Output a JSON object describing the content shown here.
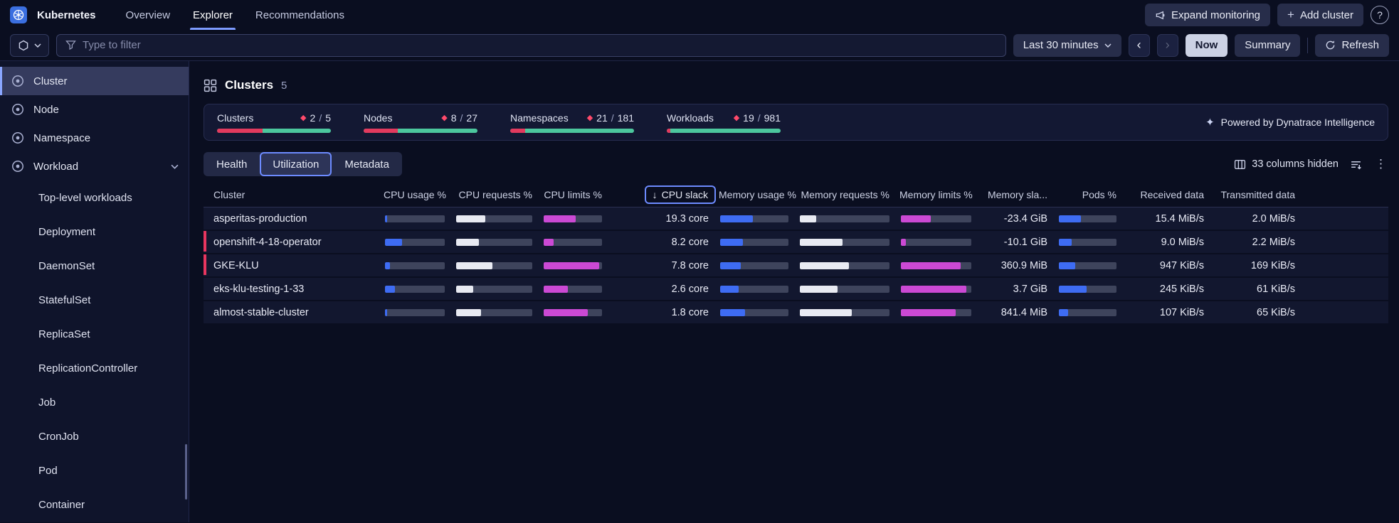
{
  "icons": {
    "help": "?",
    "plus": "+",
    "kebab": "⋮",
    "diamond": "◆",
    "sort_desc": "↓",
    "sparkle": "✦",
    "prev": "‹",
    "next": "›"
  },
  "misc": {
    "fraction_separator": "/"
  },
  "colors": {
    "accent": "#7d9bff",
    "bar_blue": "#3e6cf3",
    "bar_magenta": "#cb49d4",
    "bar_neutral": "#e8eaf2",
    "critical": "#e8365f",
    "healthy": "#4cc79e"
  },
  "app": {
    "title": "Kubernetes"
  },
  "topnav": {
    "items": [
      {
        "label": "Overview",
        "active": false
      },
      {
        "label": "Explorer",
        "active": true
      },
      {
        "label": "Recommendations",
        "active": false
      }
    ],
    "actions": {
      "expand_monitoring": "Expand monitoring",
      "add_cluster": "Add cluster"
    }
  },
  "toolbar": {
    "filter_placeholder": "Type to filter",
    "time_range": "Last 30 minutes",
    "now": "Now",
    "summary": "Summary",
    "refresh": "Refresh"
  },
  "sidebar": {
    "items": [
      {
        "label": "Cluster",
        "selected": true,
        "expanded": false
      },
      {
        "label": "Node",
        "selected": false,
        "expanded": false
      },
      {
        "label": "Namespace",
        "selected": false,
        "expanded": false
      },
      {
        "label": "Workload",
        "selected": false,
        "expanded": true
      }
    ],
    "workload_children": [
      "Top-level workloads",
      "Deployment",
      "DaemonSet",
      "StatefulSet",
      "ReplicaSet",
      "ReplicationController",
      "Job",
      "CronJob",
      "Pod",
      "Container"
    ]
  },
  "main": {
    "title": "Clusters",
    "count": "5",
    "stats": [
      {
        "label": "Clusters",
        "problematic": "2",
        "total": "5",
        "pct": 40
      },
      {
        "label": "Nodes",
        "problematic": "8",
        "total": "27",
        "pct": 30
      },
      {
        "label": "Namespaces",
        "problematic": "21",
        "total": "181",
        "pct": 12
      },
      {
        "label": "Workloads",
        "problematic": "19",
        "total": "981",
        "pct": 3
      }
    ],
    "powered_by": "Powered by Dynatrace Intelligence",
    "tabs": [
      "Health",
      "Utilization",
      "Metadata"
    ],
    "selected_tab": 1,
    "columns_hidden": "33 columns hidden",
    "table": {
      "columns": [
        {
          "label": "Cluster",
          "field": "cluster",
          "type": "text"
        },
        {
          "label": "CPU usage %",
          "field": "cpu_usage",
          "type": "bar",
          "color": "blue"
        },
        {
          "label": "CPU requests %",
          "field": "cpu_requests",
          "type": "bar",
          "color": "white"
        },
        {
          "label": "CPU limits %",
          "field": "cpu_limits",
          "type": "bar",
          "color": "magenta"
        },
        {
          "label": "CPU slack",
          "field": "cpu_slack",
          "type": "value",
          "sorted": true
        },
        {
          "label": "Memory usage %",
          "field": "mem_usage",
          "type": "bar",
          "color": "blue"
        },
        {
          "label": "Memory requests %",
          "field": "mem_requests",
          "type": "bar",
          "color": "white"
        },
        {
          "label": "Memory limits %",
          "field": "mem_limits",
          "type": "bar",
          "color": "magenta"
        },
        {
          "label": "Memory sla...",
          "field": "mem_slack",
          "type": "value"
        },
        {
          "label": "Pods %",
          "field": "pods",
          "type": "bar",
          "color": "blue"
        },
        {
          "label": "Received data",
          "field": "received",
          "type": "value"
        },
        {
          "label": "Transmitted data",
          "field": "transmitted",
          "type": "value"
        }
      ],
      "rows": [
        {
          "cluster": "asperitas-production",
          "critical": false,
          "cpu_usage": 4,
          "cpu_requests": 38,
          "cpu_limits": 55,
          "cpu_slack": "19.3 core",
          "mem_usage": 48,
          "mem_requests": 18,
          "mem_limits": 42,
          "mem_slack": "-23.4 GiB",
          "pods": 38,
          "received": "15.4 MiB/s",
          "transmitted": "2.0 MiB/s"
        },
        {
          "cluster": "openshift-4-18-operator",
          "critical": true,
          "cpu_usage": 28,
          "cpu_requests": 30,
          "cpu_limits": 17,
          "cpu_slack": "8.2 core",
          "mem_usage": 33,
          "mem_requests": 48,
          "mem_limits": 7,
          "mem_slack": "-10.1 GiB",
          "pods": 22,
          "received": "9.0 MiB/s",
          "transmitted": "2.2 MiB/s"
        },
        {
          "cluster": "GKE-KLU",
          "critical": true,
          "cpu_usage": 8,
          "cpu_requests": 48,
          "cpu_limits": 95,
          "cpu_slack": "7.8 core",
          "mem_usage": 30,
          "mem_requests": 55,
          "mem_limits": 85,
          "mem_slack": "360.9 MiB",
          "pods": 28,
          "received": "947 KiB/s",
          "transmitted": "169 KiB/s"
        },
        {
          "cluster": "eks-klu-testing-1-33",
          "critical": false,
          "cpu_usage": 17,
          "cpu_requests": 22,
          "cpu_limits": 42,
          "cpu_slack": "2.6 core",
          "mem_usage": 27,
          "mem_requests": 42,
          "mem_limits": 93,
          "mem_slack": "3.7 GiB",
          "pods": 48,
          "received": "245 KiB/s",
          "transmitted": "61 KiB/s"
        },
        {
          "cluster": "almost-stable-cluster",
          "critical": false,
          "cpu_usage": 4,
          "cpu_requests": 33,
          "cpu_limits": 75,
          "cpu_slack": "1.8 core",
          "mem_usage": 36,
          "mem_requests": 58,
          "mem_limits": 78,
          "mem_slack": "841.4 MiB",
          "pods": 16,
          "received": "107 KiB/s",
          "transmitted": "65 KiB/s"
        }
      ]
    }
  }
}
